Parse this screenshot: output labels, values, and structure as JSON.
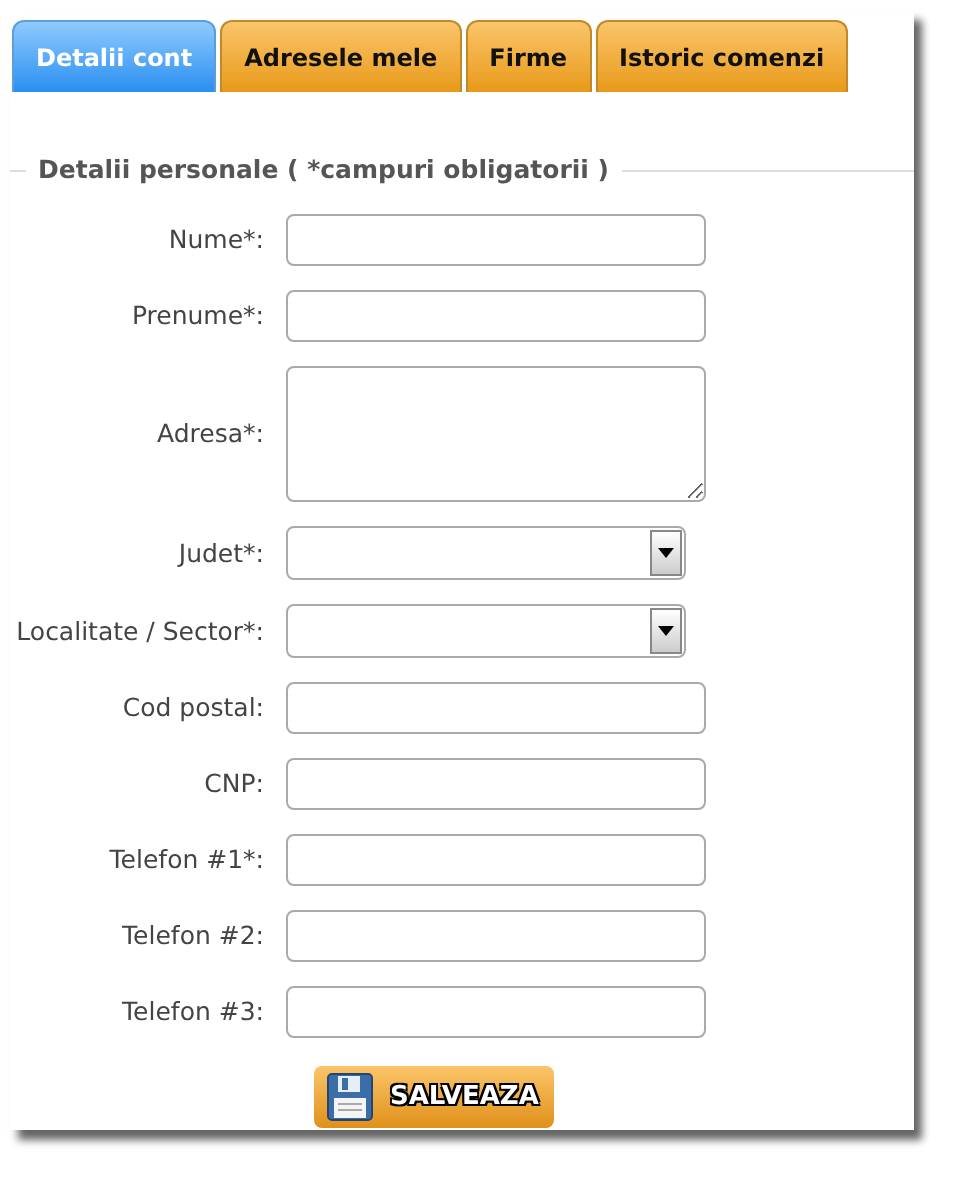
{
  "tabs": [
    {
      "label": "Detalii cont",
      "selected": true
    },
    {
      "label": "Adresele mele",
      "selected": false
    },
    {
      "label": "Firme",
      "selected": false
    },
    {
      "label": "Istoric comenzi",
      "selected": false
    }
  ],
  "section": {
    "legend": "Detalii personale ( *campuri obligatorii )"
  },
  "fields": [
    {
      "label": "Nume*:",
      "kind": "text"
    },
    {
      "label": "Prenume*:",
      "kind": "text"
    },
    {
      "label": "Adresa*:",
      "kind": "textarea"
    },
    {
      "label": "Judet*:",
      "kind": "select"
    },
    {
      "label": "Localitate / Sector*:",
      "kind": "select"
    },
    {
      "label": "Cod postal:",
      "kind": "text"
    },
    {
      "label": "CNP:",
      "kind": "text"
    },
    {
      "label": "Telefon #1*:",
      "kind": "text"
    },
    {
      "label": "Telefon #2:",
      "kind": "text"
    },
    {
      "label": "Telefon #3:",
      "kind": "text"
    }
  ],
  "save_button": {
    "label": "SALVEAZA"
  }
}
